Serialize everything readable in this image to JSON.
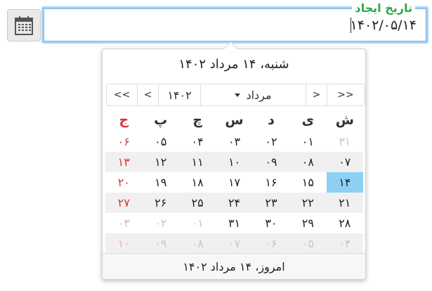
{
  "field": {
    "label": "تاریخ ایجاد",
    "value": "۱۴۰۲/۰۵/۱۴"
  },
  "calendar_button": {
    "icon": "calendar-icon"
  },
  "popup": {
    "header": "شنبه، ۱۴ مرداد ۱۴۰۲",
    "nav": {
      "prev_year": "<<",
      "prev_month": "<",
      "year": "۱۴۰۲",
      "month": "مرداد",
      "next_month": ">",
      "next_year": ">>"
    },
    "weekdays": [
      "ش",
      "ی",
      "د",
      "س",
      "چ",
      "پ",
      "ج"
    ],
    "weeks": [
      [
        {
          "d": "۳۱",
          "m": true
        },
        {
          "d": "۰۱"
        },
        {
          "d": "۰۲"
        },
        {
          "d": "۰۳"
        },
        {
          "d": "۰۴"
        },
        {
          "d": "۰۵"
        },
        {
          "d": "۰۶"
        }
      ],
      [
        {
          "d": "۰۷"
        },
        {
          "d": "۰۸"
        },
        {
          "d": "۰۹"
        },
        {
          "d": "۱۰"
        },
        {
          "d": "۱۱"
        },
        {
          "d": "۱۲"
        },
        {
          "d": "۱۳"
        }
      ],
      [
        {
          "d": "۱۴",
          "sel": true
        },
        {
          "d": "۱۵"
        },
        {
          "d": "۱۶"
        },
        {
          "d": "۱۷"
        },
        {
          "d": "۱۸"
        },
        {
          "d": "۱۹"
        },
        {
          "d": "۲۰"
        }
      ],
      [
        {
          "d": "۲۱"
        },
        {
          "d": "۲۲"
        },
        {
          "d": "۲۳"
        },
        {
          "d": "۲۴"
        },
        {
          "d": "۲۵"
        },
        {
          "d": "۲۶"
        },
        {
          "d": "۲۷"
        }
      ],
      [
        {
          "d": "۲۸"
        },
        {
          "d": "۲۹"
        },
        {
          "d": "۳۰"
        },
        {
          "d": "۳۱"
        },
        {
          "d": "۰۱",
          "m": true
        },
        {
          "d": "۰۲",
          "m": true
        },
        {
          "d": "۰۳",
          "m": true
        }
      ],
      [
        {
          "d": "۰۴",
          "m": true
        },
        {
          "d": "۰۵",
          "m": true
        },
        {
          "d": "۰۶",
          "m": true
        },
        {
          "d": "۰۷",
          "m": true
        },
        {
          "d": "۰۸",
          "m": true
        },
        {
          "d": "۰۹",
          "m": true
        },
        {
          "d": "۱۰",
          "m": true
        }
      ]
    ],
    "footer": "امروز، ۱۴ مرداد ۱۴۰۲"
  },
  "colors": {
    "accent_label": "#2aa84a",
    "selected_day": "#8dd0f4",
    "friday": "#d9343a",
    "focus_border": "#a9d3f5"
  }
}
